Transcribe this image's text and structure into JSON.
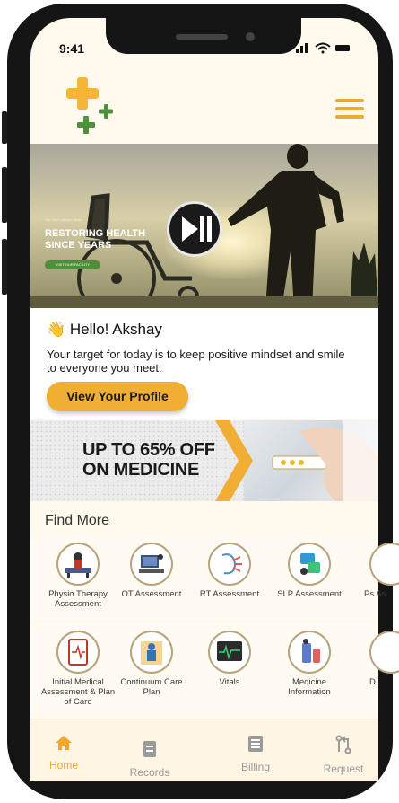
{
  "status_bar": {
    "time": "9:41",
    "icons": "ıl ᯤ ▬"
  },
  "hero": {
    "small_text": "Get Your Lifestyle Back",
    "headline_1": "RESTORING HEALTH",
    "headline_2": "SINCE YEARS",
    "cta": "VISIT OUR FACILITY"
  },
  "greeting": {
    "emoji": "👋",
    "hello": "Hello! Akshay",
    "message": "Your target for today is to keep  positive mindset and smile to everyone you meet.",
    "profile_button": "View Your Profile"
  },
  "promo": {
    "line1": "UP TO 65% OFF",
    "line2": "ON MEDICINE"
  },
  "find_more": {
    "title": "Find More",
    "row1": [
      {
        "label": "Physio Therapy Assessment",
        "icon": "physio-icon"
      },
      {
        "label": "OT Assessment",
        "icon": "ot-icon"
      },
      {
        "label": "RT Assessment",
        "icon": "rt-icon"
      },
      {
        "label": "SLP Assessment",
        "icon": "slp-icon"
      },
      {
        "label": "Ps As",
        "icon": "psych-icon"
      }
    ],
    "row2": [
      {
        "label": "Initial Medical Assessment & Plan of Care",
        "icon": "medical-icon"
      },
      {
        "label": "Continuum Care Plan",
        "icon": "care-plan-icon"
      },
      {
        "label": "Vitals",
        "icon": "vitals-icon"
      },
      {
        "label": "Medicine Information",
        "icon": "medicine-icon"
      },
      {
        "label": "D",
        "icon": "doctor-icon"
      }
    ]
  },
  "bottom_nav": [
    {
      "label": "Home",
      "active": true
    },
    {
      "label": "Records",
      "active": false
    },
    {
      "label": "Billing",
      "active": false
    },
    {
      "label": "Request",
      "active": false
    }
  ],
  "colors": {
    "accent": "#f0a92a",
    "green": "#4d8f3a",
    "background": "#fff9ee"
  }
}
